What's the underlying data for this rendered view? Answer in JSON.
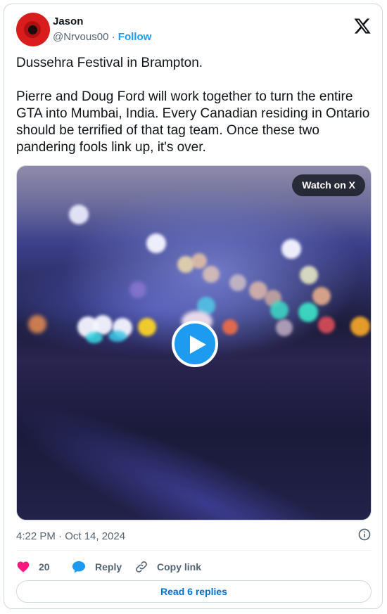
{
  "author": {
    "name": "Jason",
    "handle": "@Nrvous00",
    "separator": "·",
    "follow_label": "Follow",
    "avatar_icon": "poppy-avatar-icon"
  },
  "tweet": {
    "paragraphs": [
      "Dussehra Festival in Brampton.",
      "Pierre and Doug Ford will work together to turn the entire GTA into Mumbai, India. Every Canadian residing in Ontario should be terrified of that tag team. Once these two pandering fools link up, it's over."
    ]
  },
  "media": {
    "watch_label": "Watch on X",
    "play_icon": "play-icon"
  },
  "meta": {
    "timestamp": "4:22 PM · Oct 14, 2024",
    "info_icon": "info-icon"
  },
  "actions": {
    "likes": "20",
    "reply_label": "Reply",
    "copy_label": "Copy link"
  },
  "read_replies_label": "Read 6 replies",
  "colors": {
    "accent": "#1d9bf0",
    "link": "#006fd6",
    "like": "#f91880",
    "muted": "#536471"
  }
}
